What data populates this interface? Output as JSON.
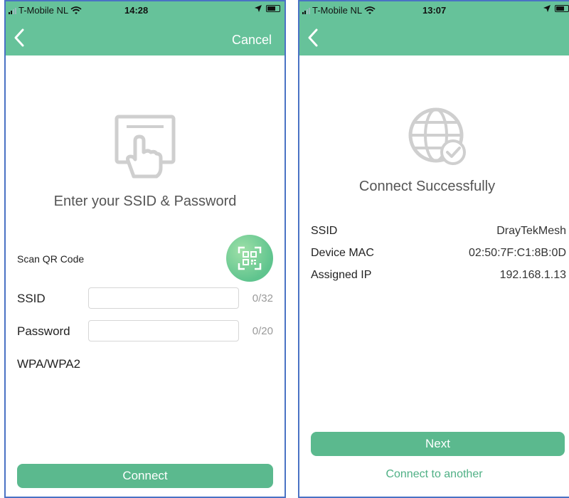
{
  "left": {
    "status": {
      "carrier": "T-Mobile NL",
      "time": "14:28"
    },
    "nav": {
      "cancel": "Cancel"
    },
    "title": "Enter your SSID & Password",
    "scan_label": "Scan QR Code",
    "ssid": {
      "label": "SSID",
      "value": "",
      "count": "0/32"
    },
    "password": {
      "label": "Password",
      "value": "",
      "count": "0/20"
    },
    "security": "WPA/WPA2",
    "connect": "Connect"
  },
  "right": {
    "status": {
      "carrier": "T-Mobile NL",
      "time": "13:07"
    },
    "title": "Connect Successfully",
    "rows": [
      {
        "label": "SSID",
        "value": "DrayTekMesh"
      },
      {
        "label": "Device MAC",
        "value": "02:50:7F:C1:8B:0D"
      },
      {
        "label": "Assigned IP",
        "value": "192.168.1.13"
      }
    ],
    "next": "Next",
    "another": "Connect to another"
  },
  "colors": {
    "header": "#66c29a",
    "button": "#5bb98e",
    "link": "#4fb085",
    "frame": "#4a72c4"
  },
  "icons": [
    "back-chevron-icon",
    "hand-tap-icon",
    "qr-scan-icon",
    "globe-check-icon",
    "wifi-icon",
    "location-arrow-icon",
    "battery-icon",
    "signal-icon"
  ]
}
